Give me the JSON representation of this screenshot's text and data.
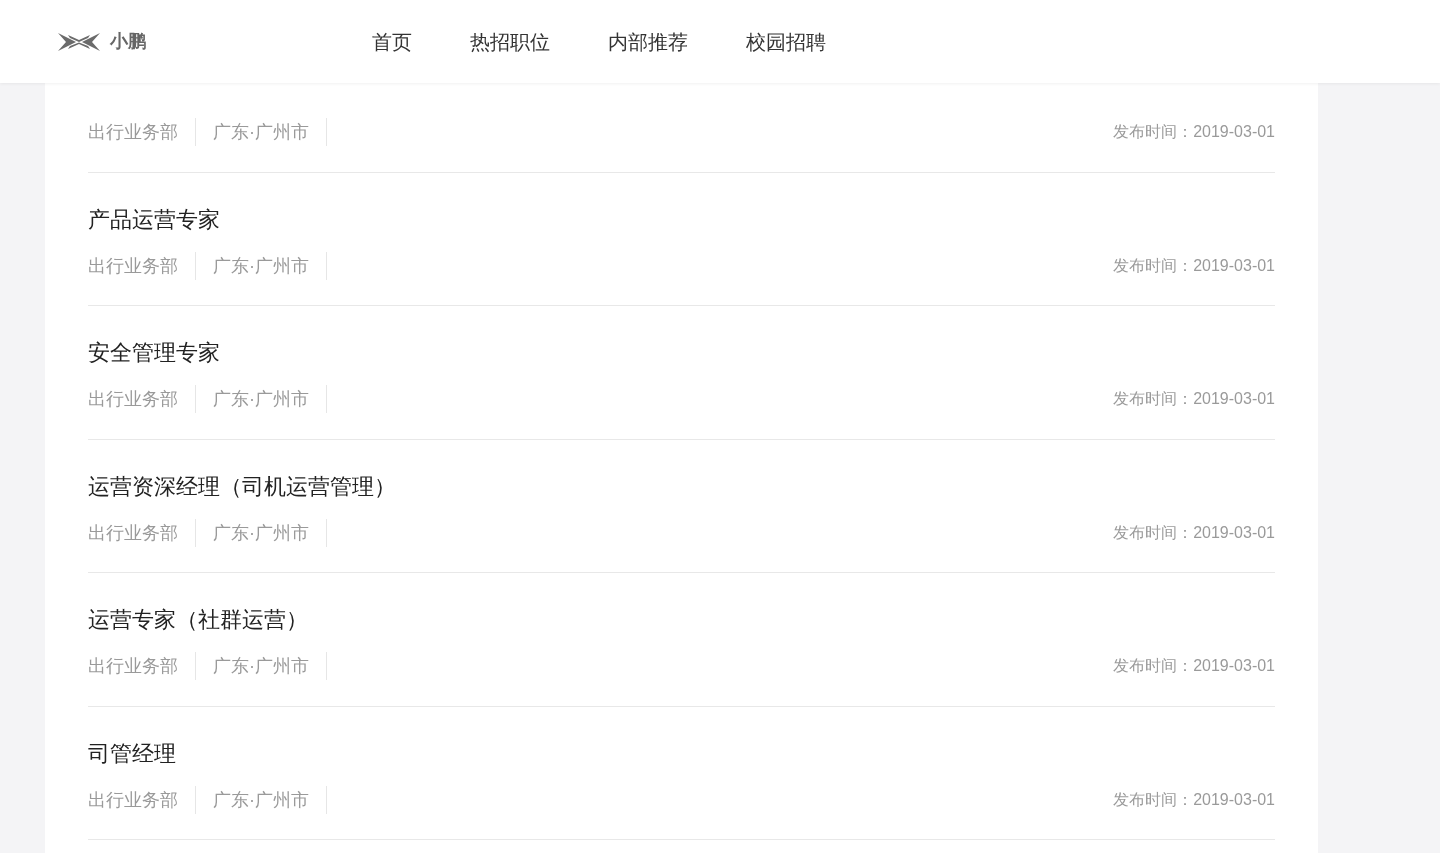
{
  "header": {
    "logo_text": "小鹏",
    "nav": [
      "首页",
      "热招职位",
      "内部推荐",
      "校园招聘"
    ]
  },
  "jobs": [
    {
      "department": "出行业务部",
      "location": "广东·广州市",
      "posted": "发布时间：2019-03-01"
    },
    {
      "title": "产品运营专家",
      "department": "出行业务部",
      "location": "广东·广州市",
      "posted": "发布时间：2019-03-01"
    },
    {
      "title": "安全管理专家",
      "department": "出行业务部",
      "location": "广东·广州市",
      "posted": "发布时间：2019-03-01"
    },
    {
      "title": "运营资深经理（司机运营管理）",
      "department": "出行业务部",
      "location": "广东·广州市",
      "posted": "发布时间：2019-03-01"
    },
    {
      "title": "运营专家（社群运营）",
      "department": "出行业务部",
      "location": "广东·广州市",
      "posted": "发布时间：2019-03-01"
    },
    {
      "title": "司管经理",
      "department": "出行业务部",
      "location": "广东·广州市",
      "posted": "发布时间：2019-03-01"
    }
  ]
}
